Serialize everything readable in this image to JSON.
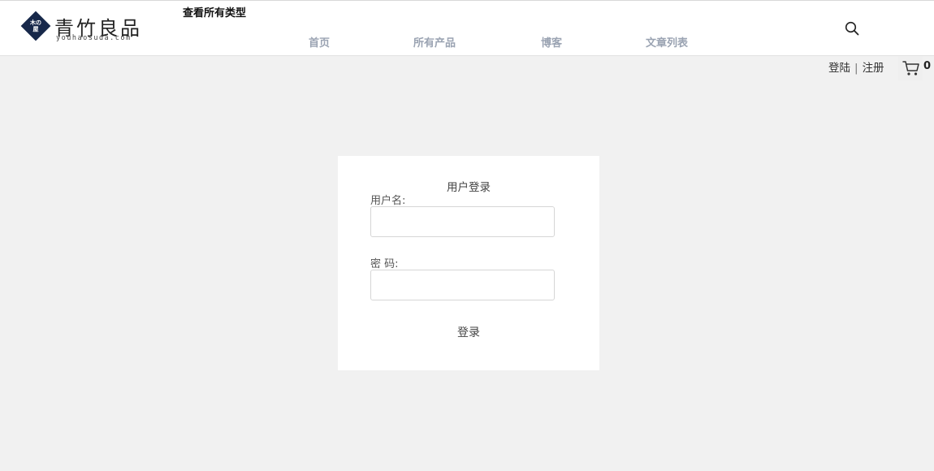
{
  "brand": {
    "name": "青竹良品",
    "url": "youhaosuda.com",
    "mark_lines": [
      "木の",
      "屋"
    ]
  },
  "header": {
    "all_types": "查看所有类型",
    "nav": [
      "首页",
      "所有产品",
      "博客",
      "文章列表"
    ],
    "search_icon": "search-icon"
  },
  "user_bar": {
    "login": "登陆",
    "separator": "|",
    "register": "注册",
    "cart_icon": "cart-icon",
    "cart_count": "0"
  },
  "login_form": {
    "title": "用户登录",
    "username_label": "用户名:",
    "username_value": "",
    "password_label": "密 码:",
    "password_value": "",
    "submit_label": "登录"
  },
  "colors": {
    "page_bg": "#f1f1f1",
    "nav_text": "#9aa3b2",
    "logo_navy": "#17284a"
  }
}
